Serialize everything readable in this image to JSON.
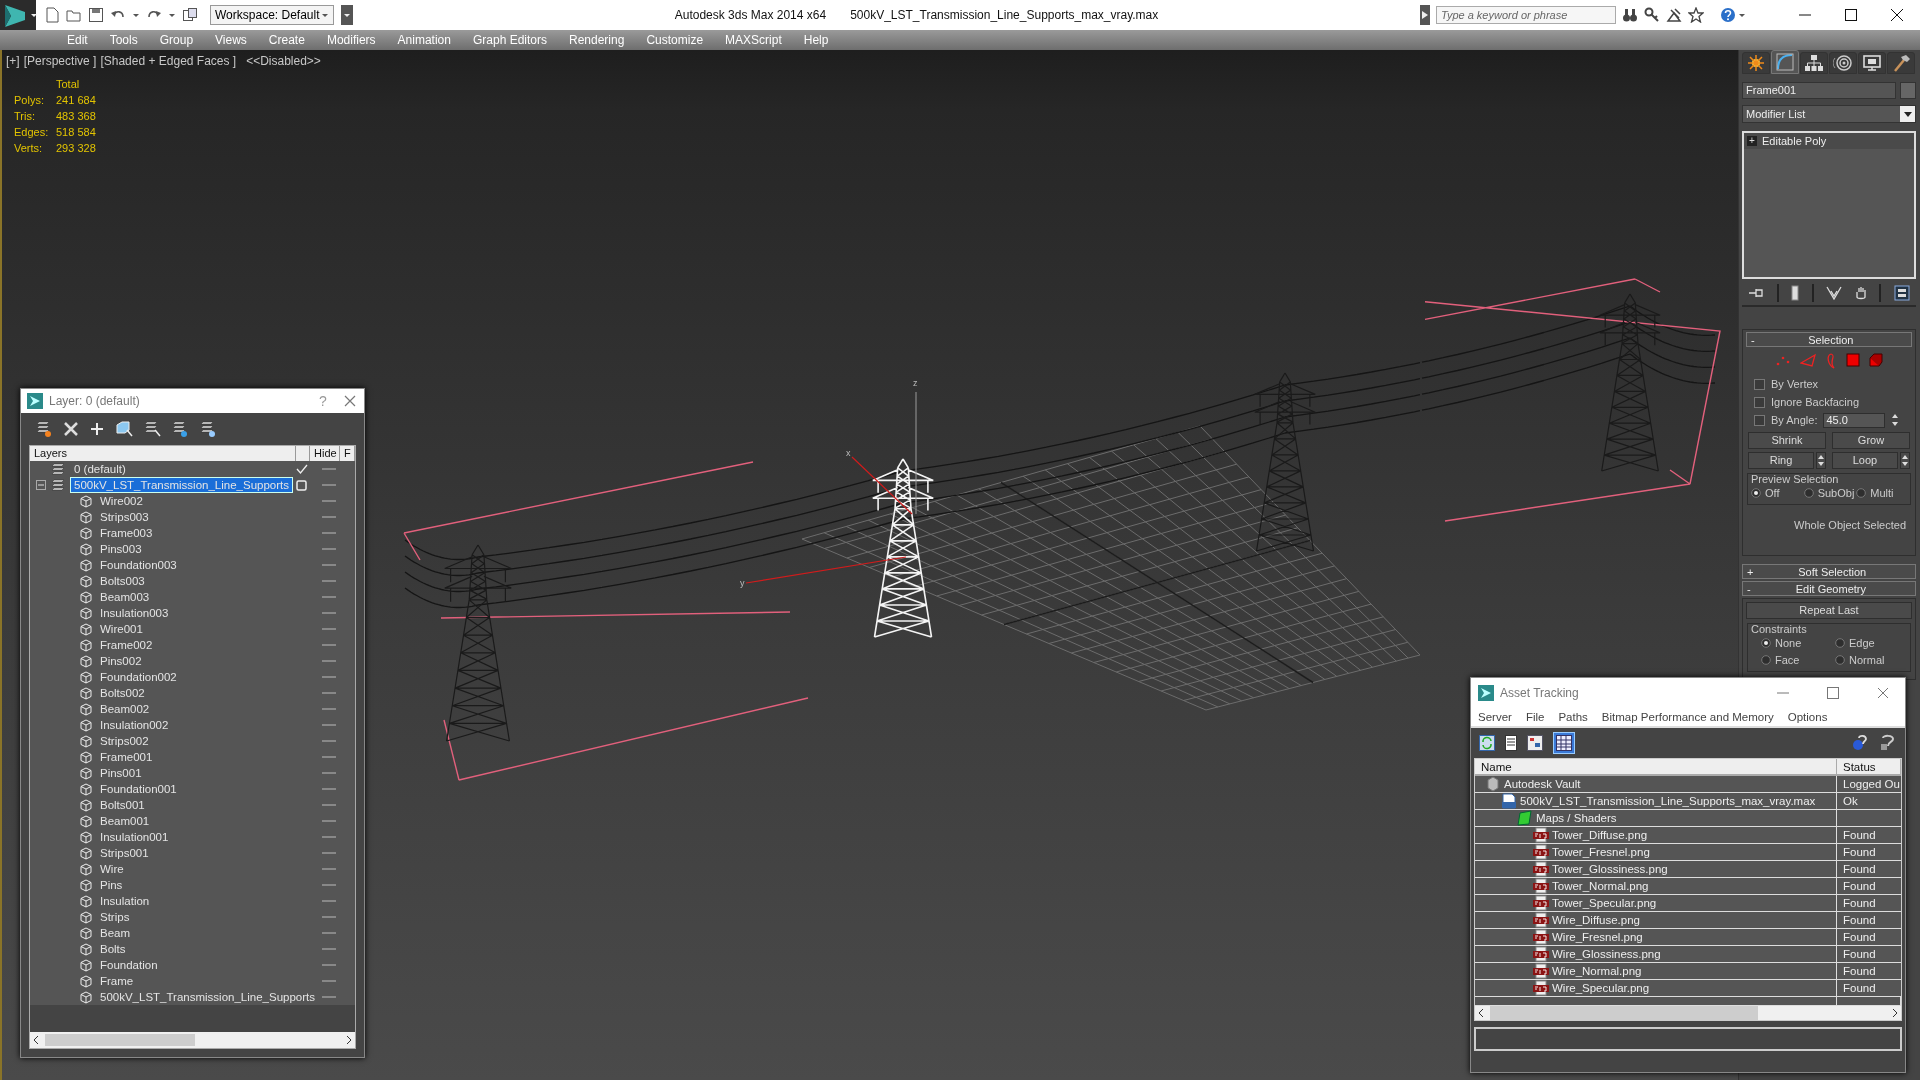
{
  "title_bar": {
    "workspace": "Workspace: Default",
    "app_title": "Autodesk 3ds Max  2014 x64",
    "file_title": "500kV_LST_Transmission_Line_Supports_max_vray.max",
    "search": {
      "placeholder": "Type a keyword or phrase"
    }
  },
  "menu": [
    "Edit",
    "Tools",
    "Group",
    "Views",
    "Create",
    "Modifiers",
    "Animation",
    "Graph Editors",
    "Rendering",
    "Customize",
    "MAXScript",
    "Help"
  ],
  "viewport": {
    "labels": [
      "[+]",
      "[Perspective ]",
      "[Shaded + Edged Faces ]",
      "<<Disabled>>"
    ],
    "stats": {
      "header": "Total",
      "rows": [
        {
          "label": "Polys:",
          "value": "241 684"
        },
        {
          "label": "Tris:",
          "value": "483 368"
        },
        {
          "label": "Edges:",
          "value": "518 584"
        },
        {
          "label": "Verts:",
          "value": "293 328"
        }
      ]
    },
    "axis_labels": [
      "z",
      "x",
      "y"
    ],
    "towers": [
      {
        "selected": false
      },
      {
        "selected": true
      },
      {
        "selected": false
      },
      {
        "selected": false
      }
    ]
  },
  "layer_window": {
    "title": "Layer: 0 (default)",
    "help": "?",
    "columns": [
      "Layers",
      "Hide",
      "F"
    ],
    "layers": [
      {
        "name": "0 (default)",
        "current": true,
        "selected": false
      },
      {
        "name": "500kV_LST_Transmission_Line_Supports",
        "current": false,
        "selected": true,
        "expanded": true,
        "children": [
          {
            "name": "Wire002"
          },
          {
            "name": "Strips003"
          },
          {
            "name": "Frame003"
          },
          {
            "name": "Pins003"
          },
          {
            "name": "Foundation003"
          },
          {
            "name": "Bolts003"
          },
          {
            "name": "Beam003"
          },
          {
            "name": "Insulation003"
          },
          {
            "name": "Wire001"
          },
          {
            "name": "Frame002"
          },
          {
            "name": "Pins002"
          },
          {
            "name": "Foundation002"
          },
          {
            "name": "Bolts002"
          },
          {
            "name": "Beam002"
          },
          {
            "name": "Insulation002"
          },
          {
            "name": "Strips002"
          },
          {
            "name": "Frame001"
          },
          {
            "name": "Pins001"
          },
          {
            "name": "Foundation001"
          },
          {
            "name": "Bolts001"
          },
          {
            "name": "Beam001"
          },
          {
            "name": "Insulation001"
          },
          {
            "name": "Strips001"
          },
          {
            "name": "Wire"
          },
          {
            "name": "Pins"
          },
          {
            "name": "Insulation"
          },
          {
            "name": "Strips"
          },
          {
            "name": "Beam"
          },
          {
            "name": "Bolts"
          },
          {
            "name": "Foundation"
          },
          {
            "name": "Frame"
          },
          {
            "name": "500kV_LST_Transmission_Line_Supports"
          }
        ]
      }
    ]
  },
  "command_panel": {
    "tabs": [
      {
        "kind": "create",
        "selected": false
      },
      {
        "kind": "modify",
        "selected": true
      },
      {
        "kind": "hierarchy",
        "selected": false
      },
      {
        "kind": "motion",
        "selected": false
      },
      {
        "kind": "display",
        "selected": false
      },
      {
        "kind": "utilities",
        "selected": false
      }
    ],
    "object_name": "Frame001",
    "modifier_list": "Modifier List",
    "stack": [
      {
        "name": "Editable Poly",
        "toggle": "+"
      }
    ],
    "selection": {
      "toggle": "-",
      "title": "Selection",
      "checkboxes": [
        {
          "label": "By Vertex",
          "checked": false
        },
        {
          "label": "Ignore Backfacing",
          "checked": false
        },
        {
          "label": "By Angle:",
          "checked": false,
          "value": "45.0"
        }
      ],
      "buttons": [
        "Shrink",
        "Grow"
      ],
      "spinner_buttons": [
        "Ring",
        "Loop"
      ],
      "preview": {
        "title": "Preview Selection",
        "options": [
          {
            "label": "Off",
            "selected": true
          },
          {
            "label": "SubObj",
            "selected": false
          },
          {
            "label": "Multi",
            "selected": false
          }
        ]
      },
      "status": "Whole Object Selected"
    },
    "rollouts": [
      {
        "toggle": "+",
        "title": "Soft Selection"
      },
      {
        "toggle": "-",
        "title": "Edit Geometry"
      }
    ],
    "edit_geometry": {
      "button": "Repeat Last",
      "constraints": {
        "title": "Constraints",
        "options": [
          {
            "label": "None",
            "selected": true
          },
          {
            "label": "Edge",
            "selected": false
          },
          {
            "label": "Face",
            "selected": false
          },
          {
            "label": "Normal",
            "selected": false
          }
        ]
      }
    }
  },
  "asset_window": {
    "title": "Asset Tracking",
    "menu": [
      "Server",
      "File",
      "Paths",
      "Bitmap Performance and Memory",
      "Options"
    ],
    "columns": [
      "Name",
      "Status"
    ],
    "rows": [
      {
        "kind": "vault",
        "name": "Autodesk Vault",
        "status": "Logged Ou",
        "children": [
          {
            "kind": "max",
            "name": "500kV_LST_Transmission_Line_Supports_max_vray.max",
            "status": "Ok",
            "children": [
              {
                "kind": "folder",
                "name": "Maps / Shaders",
                "children": [
                  {
                    "kind": "png",
                    "name": "Tower_Diffuse.png",
                    "status": "Found"
                  },
                  {
                    "kind": "png",
                    "name": "Tower_Fresnel.png",
                    "status": "Found"
                  },
                  {
                    "kind": "png",
                    "name": "Tower_Glossiness.png",
                    "status": "Found"
                  },
                  {
                    "kind": "png",
                    "name": "Tower_Normal.png",
                    "status": "Found"
                  },
                  {
                    "kind": "png",
                    "name": "Tower_Specular.png",
                    "status": "Found"
                  },
                  {
                    "kind": "png",
                    "name": "Wire_Diffuse.png",
                    "status": "Found"
                  },
                  {
                    "kind": "png",
                    "name": "Wire_Fresnel.png",
                    "status": "Found"
                  },
                  {
                    "kind": "png",
                    "name": "Wire_Glossiness.png",
                    "status": "Found"
                  },
                  {
                    "kind": "png",
                    "name": "Wire_Normal.png",
                    "status": "Found"
                  },
                  {
                    "kind": "png",
                    "name": "Wire_Specular.png",
                    "status": "Found"
                  }
                ]
              }
            ]
          }
        ]
      }
    ]
  }
}
